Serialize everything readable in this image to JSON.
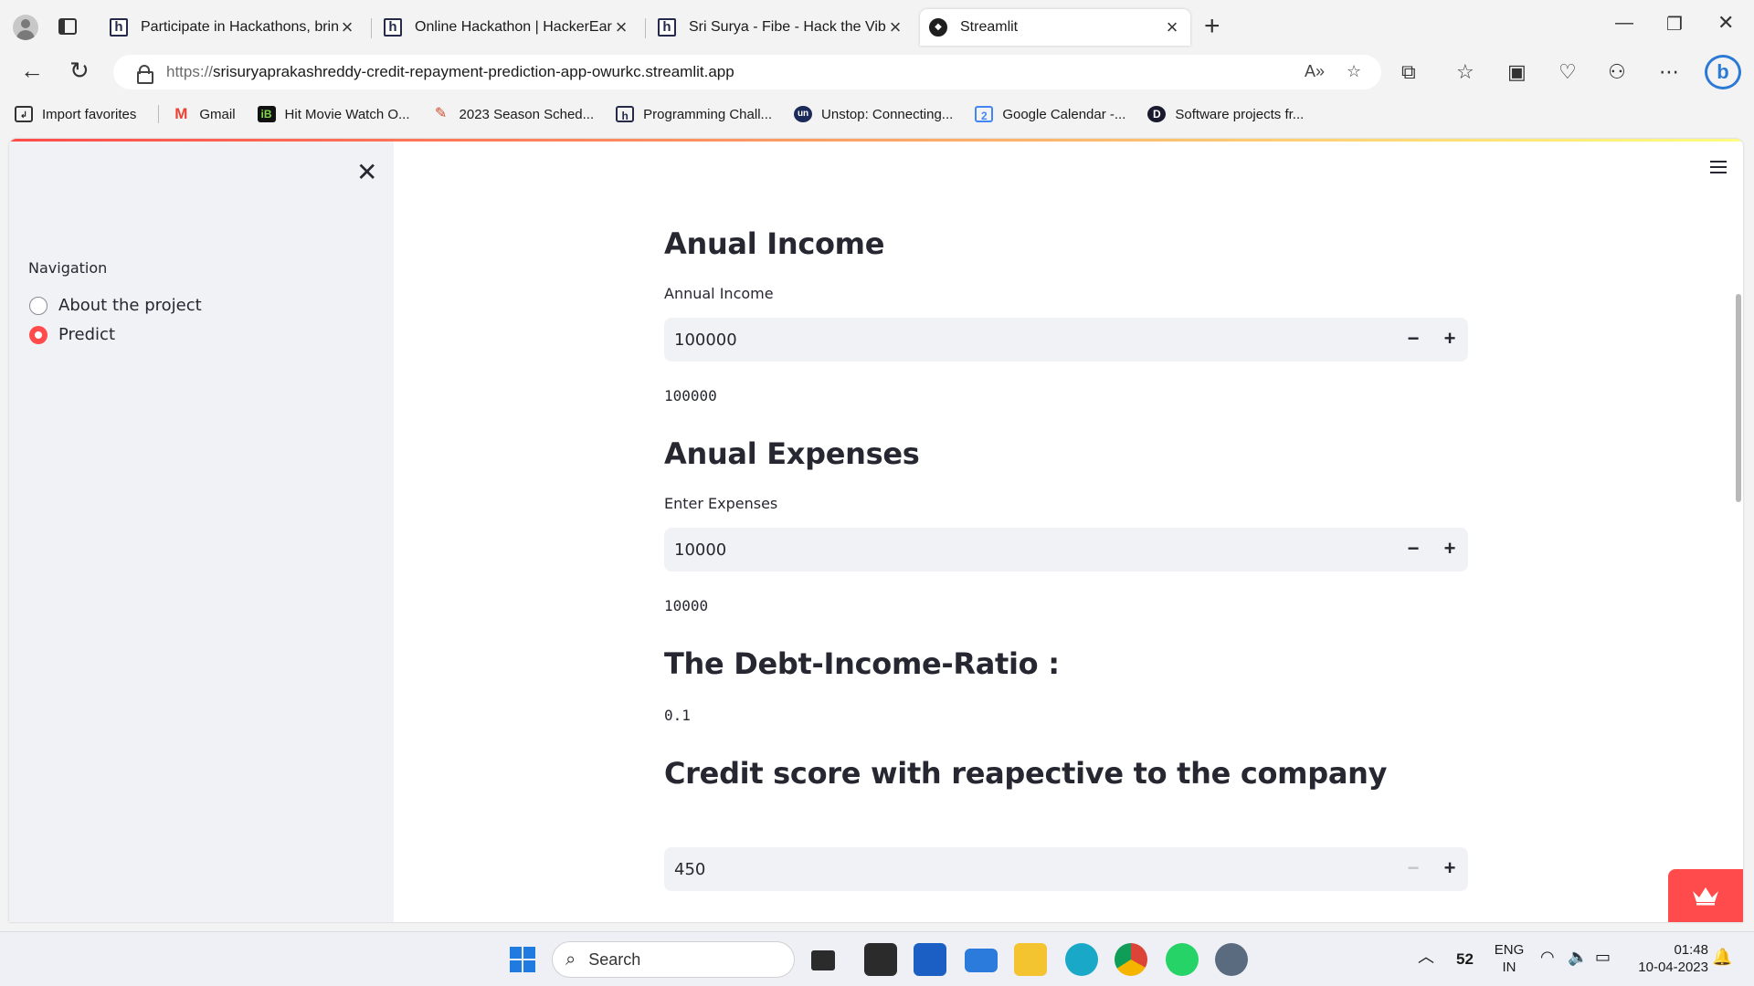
{
  "browser": {
    "tabs": [
      {
        "title": "Participate in Hackathons, bring",
        "favicon": "h"
      },
      {
        "title": "Online Hackathon | HackerEarth",
        "favicon": "h"
      },
      {
        "title": "Sri Surya - Fibe - Hack the Vibe!",
        "favicon": "h"
      },
      {
        "title": "Streamlit",
        "favicon": "streamlit-logo"
      }
    ],
    "url_protocol": "https://",
    "url_rest": "srisuryaprakashreddy-credit-repayment-prediction-app-owurkc.streamlit.app",
    "bookmarks": [
      {
        "label": "Import favorites",
        "icon": "import-icon"
      },
      {
        "label": "Gmail",
        "icon": "M"
      },
      {
        "label": "Hit Movie Watch O...",
        "icon": "iB"
      },
      {
        "label": "2023 Season Sched...",
        "icon": "calendar-pin"
      },
      {
        "label": "Programming Chall...",
        "icon": "h"
      },
      {
        "label": "Unstop: Connecting...",
        "icon": "un"
      },
      {
        "label": "Google Calendar -...",
        "icon": "2"
      },
      {
        "label": "Software projects fr...",
        "icon": "D"
      }
    ]
  },
  "sidebar": {
    "nav_label": "Navigation",
    "options": [
      {
        "label": "About the project",
        "selected": false
      },
      {
        "label": "Predict",
        "selected": true
      }
    ]
  },
  "main": {
    "income": {
      "header": "Anual Income",
      "label": "Annual Income",
      "value": "100000",
      "echo": "100000"
    },
    "expenses": {
      "header": "Anual Expenses",
      "label": "Enter Expenses",
      "value": "10000",
      "echo": "10000"
    },
    "ratio": {
      "header": "The Debt-Income-Ratio :",
      "value": "0.1"
    },
    "credit": {
      "header": "Credit score with reapective to the company",
      "value": "450"
    }
  },
  "taskbar": {
    "search": "Search",
    "temp": "52",
    "lang1": "ENG",
    "lang2": "IN",
    "time": "01:48",
    "date": "10-04-2023"
  },
  "colors": {
    "accent": "#ff4b4b",
    "sidebar_bg": "#f0f2f6",
    "input_bg": "#f0f2f6"
  }
}
